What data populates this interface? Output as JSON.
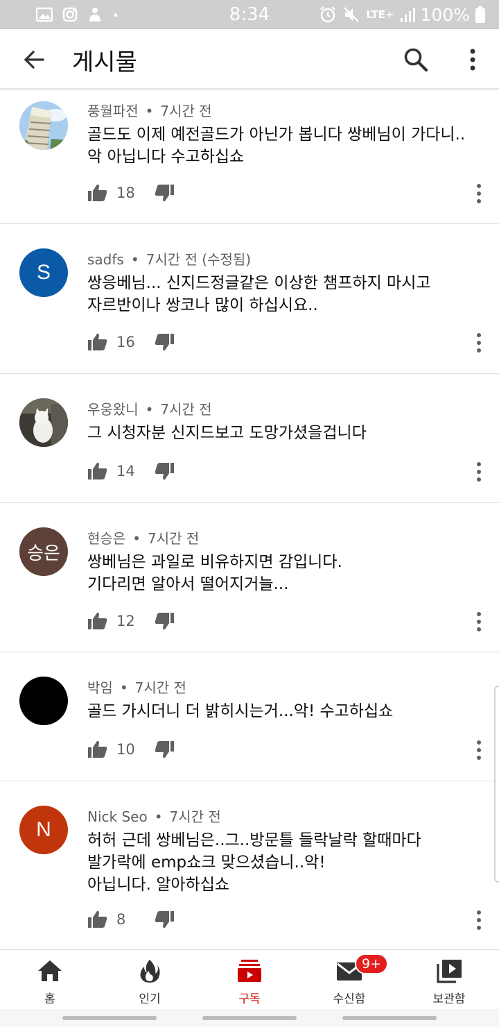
{
  "status_bar": {
    "time": "8:34",
    "network": "LTE+",
    "battery": "100%",
    "icons": [
      "gallery-icon",
      "instagram-icon",
      "notification-app-icon",
      "dot-icon",
      "alarm-icon",
      "mute-icon",
      "signal-icon",
      "battery-icon"
    ]
  },
  "app_bar": {
    "title": "게시물",
    "back_icon": "arrow-left-icon",
    "search_icon": "search-icon",
    "more_icon": "more-vertical-icon"
  },
  "comments": [
    {
      "author": "풍월파전",
      "time": "7시간 전",
      "edited": "",
      "avatar_type": "photo-building",
      "avatar_letter": "",
      "avatar_color": "#7aa7d8",
      "lines": [
        "골드도 이제 예전골드가 아닌가 봅니다 쌍베님이 가다니..",
        "악 아닙니다 수고하십쇼"
      ],
      "likes": "18"
    },
    {
      "author": "sadfs",
      "time": "7시간 전",
      "edited": "(수정됨)",
      "avatar_type": "letter",
      "avatar_letter": "S",
      "avatar_color": "#0b5aa8",
      "lines": [
        "쌍응베님... 신지드정글같은 이상한 챔프하지 마시고",
        "자르반이나 쌍코나 많이 하십시요.."
      ],
      "likes": "16"
    },
    {
      "author": "우웅왔니",
      "time": "7시간 전",
      "edited": "",
      "avatar_type": "photo-cat",
      "avatar_letter": "",
      "avatar_color": "#5a5a52",
      "lines": [
        "그 시청자분 신지드보고 도망가셨을겁니다"
      ],
      "likes": "14"
    },
    {
      "author": "현승은",
      "time": "7시간 전",
      "edited": "",
      "avatar_type": "letter",
      "avatar_letter": "승은",
      "avatar_color": "#5d4037",
      "lines": [
        "쌍베님은 과일로 비유하지면 감입니다.",
        "기다리면 알아서 떨어지거늘..."
      ],
      "likes": "12"
    },
    {
      "author": "박임",
      "time": "7시간 전",
      "edited": "",
      "avatar_type": "solid",
      "avatar_letter": "",
      "avatar_color": "#000000",
      "lines": [
        "골드 가시더니 더 밝히시는거...악! 수고하십쇼"
      ],
      "likes": "10"
    },
    {
      "author": "Nick Seo",
      "time": "7시간 전",
      "edited": "",
      "avatar_type": "letter",
      "avatar_letter": "N",
      "avatar_color": "#c1350d",
      "lines": [
        "허허 근데 쌍베님은..그..방문틀 들락날락 할때마다",
        "발가락에 emp쇼크 맞으셨습니..악!",
        "아닙니다. 알아하십쇼"
      ],
      "likes": "8"
    }
  ],
  "bottom_nav": {
    "items": [
      {
        "label": "홈",
        "icon": "home-icon",
        "active": false
      },
      {
        "label": "인기",
        "icon": "trending-fire-icon",
        "active": false
      },
      {
        "label": "구독",
        "icon": "subscriptions-icon",
        "active": true
      },
      {
        "label": "수신함",
        "icon": "inbox-mail-icon",
        "active": false
      },
      {
        "label": "보관함",
        "icon": "library-icon",
        "active": false
      }
    ],
    "inbox_badge": "9+"
  },
  "colors": {
    "accent": "#cc0000",
    "badge": "#e41e1e",
    "secondary_text": "#606060",
    "status_bar": "#cfcfcf"
  }
}
